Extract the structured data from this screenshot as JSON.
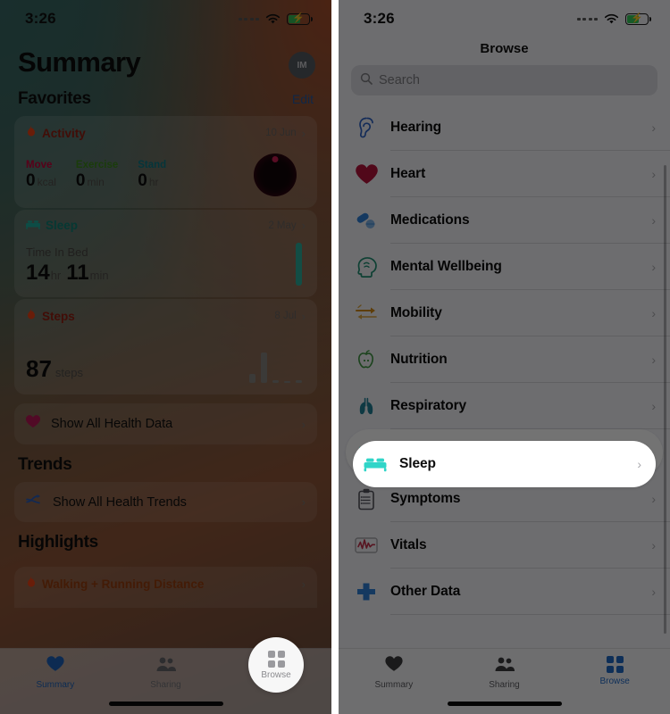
{
  "status_bar": {
    "time": "3:26",
    "wifi_icon": "wifi-icon",
    "battery_icon": "battery-charging-icon"
  },
  "left_screen": {
    "title": "Summary",
    "avatar_initials": "IM",
    "favorites": {
      "heading": "Favorites",
      "edit_label": "Edit",
      "cards": [
        {
          "name": "activity",
          "title": "Activity",
          "icon": "flame-icon",
          "icon_color": "#fa4616",
          "title_color": "#9c1f12",
          "date": "10 Jun",
          "metrics": [
            {
              "label": "Move",
              "label_color": "#d1003c",
              "value": "0",
              "unit": "kcal"
            },
            {
              "label": "Exercise",
              "label_color": "#3f8f1c",
              "value": "0",
              "unit": "min"
            },
            {
              "label": "Stand",
              "label_color": "#0d7f8c",
              "value": "0",
              "unit": "hr"
            }
          ]
        },
        {
          "name": "sleep",
          "title": "Sleep",
          "icon": "bed-icon",
          "icon_color": "#1fb8a6",
          "title_color": "#10857a",
          "date": "2 May",
          "time_in_bed_label": "Time In Bed",
          "hours": "14",
          "hours_unit": "hr",
          "minutes": "11",
          "minutes_unit": "min"
        },
        {
          "name": "steps",
          "title": "Steps",
          "icon": "flame-icon",
          "icon_color": "#fa4616",
          "title_color": "#9c1f12",
          "date": "8 Jul",
          "value": "87",
          "unit": "steps"
        }
      ],
      "show_all_health_data": {
        "label": "Show All Health Data",
        "icon": "heart-icon"
      }
    },
    "trends": {
      "heading": "Trends",
      "show_all_health_trends": {
        "label": "Show All Health Trends",
        "icon": "trends-icon"
      }
    },
    "highlights": {
      "heading": "Highlights",
      "first_item": {
        "label": "Walking + Running Distance",
        "icon": "flame-icon"
      }
    },
    "tabbar": [
      {
        "label": "Summary",
        "icon": "heart-icon",
        "active": true
      },
      {
        "label": "Sharing",
        "icon": "people-icon",
        "active": false
      },
      {
        "label": "Browse",
        "icon": "grid-icon",
        "active": false
      }
    ],
    "browse_fab": {
      "label": "Browse",
      "icon": "grid-icon"
    }
  },
  "right_screen": {
    "title": "Browse",
    "search": {
      "placeholder": "Search",
      "value": "",
      "icon": "search-icon"
    },
    "rows": [
      {
        "label": "Hearing",
        "icon": "ear-icon",
        "color": "#2d62c4",
        "selected": false
      },
      {
        "label": "Heart",
        "icon": "heart-icon",
        "color": "#b3123a",
        "selected": false
      },
      {
        "label": "Medications",
        "icon": "pill-icon",
        "color": "#2f7fd4",
        "selected": false
      },
      {
        "label": "Mental Wellbeing",
        "icon": "brain-head-icon",
        "color": "#1f8f72",
        "selected": false
      },
      {
        "label": "Mobility",
        "icon": "arrows-icon",
        "color": "#d08a17",
        "selected": false
      },
      {
        "label": "Nutrition",
        "icon": "apple-icon",
        "color": "#3f9442",
        "selected": false
      },
      {
        "label": "Respiratory",
        "icon": "lungs-icon",
        "color": "#1f7f96",
        "selected": false
      },
      {
        "label": "Sleep",
        "icon": "bed-icon",
        "color": "#30d5c8",
        "selected": true
      },
      {
        "label": "Symptoms",
        "icon": "clipboard-icon",
        "color": "#53535c",
        "selected": false
      },
      {
        "label": "Vitals",
        "icon": "waveform-icon",
        "color": "#c0304a",
        "selected": false
      },
      {
        "label": "Other Data",
        "icon": "cross-icon",
        "color": "#2f7fd4",
        "selected": false
      }
    ],
    "tabbar": [
      {
        "label": "Summary",
        "icon": "heart-icon",
        "active": false
      },
      {
        "label": "Sharing",
        "icon": "people-icon",
        "active": false
      },
      {
        "label": "Browse",
        "icon": "grid-icon",
        "active": true
      }
    ]
  },
  "colors": {
    "accent_blue": "#1f68c4",
    "selected_row_bg": "#ffffff",
    "panel_bg": "#f2f2f7",
    "teal": "#30d5c8",
    "orange": "#fa4616"
  }
}
